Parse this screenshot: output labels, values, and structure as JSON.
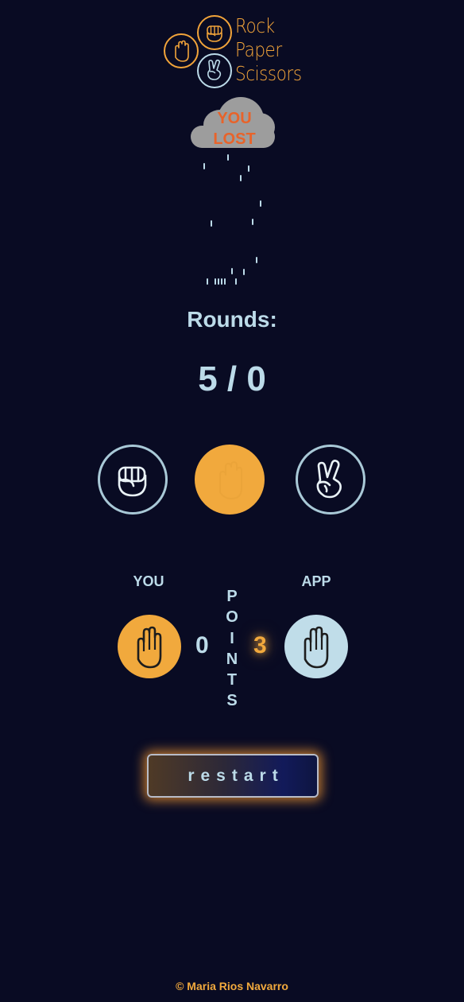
{
  "app": {
    "logo_lines": [
      "Rock",
      "Paper",
      "Scissors"
    ]
  },
  "result": {
    "line1": "YOU",
    "line2": "LOST"
  },
  "rounds": {
    "label": "Rounds:",
    "value": "5 / 0"
  },
  "choices": [
    {
      "name": "rock",
      "icon": "fist-icon"
    },
    {
      "name": "paper",
      "icon": "open-hand-icon"
    },
    {
      "name": "scissors",
      "icon": "peace-hand-icon"
    }
  ],
  "players": {
    "you_label": "YOU",
    "app_label": "APP",
    "you_hand": "open-hand-icon",
    "app_hand": "open-hand-icon"
  },
  "points": {
    "letters": [
      "P",
      "O",
      "I",
      "N",
      "T",
      "S"
    ],
    "you_score": "0",
    "app_score": "3"
  },
  "restart_label": "restart",
  "footer": "© Maria Rios Navarro",
  "colors": {
    "background": "#090b23",
    "accent_orange": "#f1a93d",
    "accent_blue": "#bcdbe9",
    "lost_text": "#e8632a",
    "cloud_gray": "#9d9d9d"
  }
}
